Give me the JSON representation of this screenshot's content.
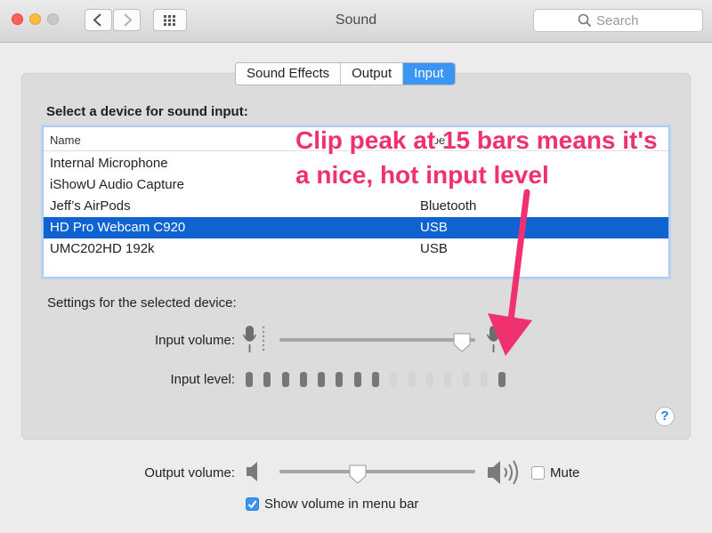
{
  "window": {
    "title": "Sound"
  },
  "search": {
    "placeholder": "Search"
  },
  "tabs": [
    {
      "label": "Sound Effects",
      "active": false
    },
    {
      "label": "Output",
      "active": false
    },
    {
      "label": "Input",
      "active": true
    }
  ],
  "input": {
    "section_title": "Select a device for sound input:",
    "table": {
      "columns": [
        "Name",
        "Type"
      ],
      "rows": [
        {
          "name": "Internal Microphone",
          "type": ""
        },
        {
          "name": "iShowU Audio Capture",
          "type": ""
        },
        {
          "name": "Jeff’s AirPods",
          "type": "Bluetooth"
        },
        {
          "name": "HD Pro Webcam C920",
          "type": "USB",
          "selected": true
        },
        {
          "name": "UMC202HD 192k",
          "type": "USB"
        }
      ]
    },
    "settings_title": "Settings for the selected device:",
    "input_volume_label": "Input volume:",
    "input_volume_level": 0.93,
    "input_level_label": "Input level:",
    "input_level_bars_total": 15,
    "input_level_bars_lit": 8,
    "input_level_peak_bar": 15
  },
  "footer": {
    "output_volume_label": "Output volume:",
    "output_volume_level": 0.4,
    "mute_label": "Mute",
    "mute_checked": false,
    "show_volume_label": "Show volume in menu bar",
    "show_volume_checked": true
  },
  "annotation": {
    "line1": "Clip peak at 15 bars means it's",
    "line2": "a nice, hot input level",
    "color": "#f0316f"
  },
  "colors": {
    "accent": "#3b95f5",
    "selection": "#0e63d0"
  }
}
